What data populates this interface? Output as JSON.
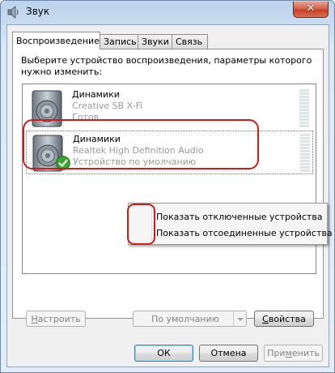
{
  "window": {
    "title": "Звук",
    "close_label": "✕"
  },
  "tabs": [
    {
      "label": "Воспроизведение",
      "active": true
    },
    {
      "label": "Запись",
      "active": false
    },
    {
      "label": "Звуки",
      "active": false
    },
    {
      "label": "Связь",
      "active": false
    }
  ],
  "panel": {
    "instruction": "Выберите устройство воспроизведения, параметры которого нужно изменить:"
  },
  "devices": [
    {
      "name": "Динамики",
      "description": "Creative SB X-Fi",
      "status": "Готов",
      "default": false,
      "selected": false
    },
    {
      "name": "Динамики",
      "description": "Realtek High Definition Audio",
      "status": "Устройство по умолчанию",
      "default": true,
      "selected": true
    }
  ],
  "context_menu": {
    "items": [
      {
        "label": "Показать отключенные устройства"
      },
      {
        "label": "Показать отсоединенные устройства"
      }
    ]
  },
  "buttons": {
    "configure_prefix": "",
    "configure_underline": "Н",
    "configure_rest": "астроить",
    "set_default": "По умолчанию",
    "properties_prefix": "",
    "properties_underline": "С",
    "properties_rest": "войства",
    "ok": "ОК",
    "cancel": "Отмена",
    "apply_prefix": "При",
    "apply_underline": "м",
    "apply_rest": "енить"
  },
  "colors": {
    "highlight_oval": "#d11a1a",
    "checkmark_green": "#3aa530",
    "disabled_text": "#838383"
  }
}
